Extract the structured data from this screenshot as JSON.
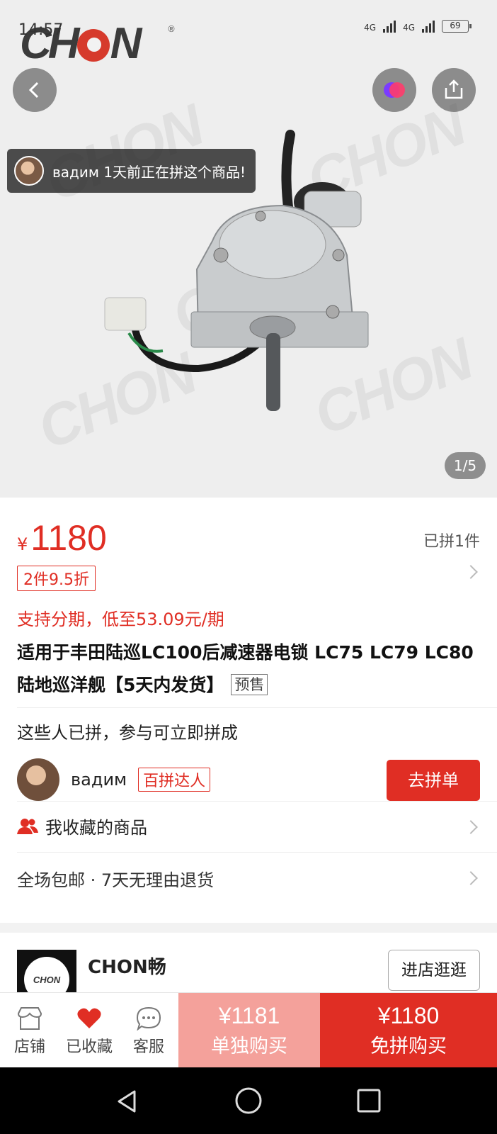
{
  "status": {
    "time": "14:57",
    "network": "4G",
    "battery": "69"
  },
  "hero": {
    "brand_logo": "CHON",
    "viewer_notice": "вадим 1天前正在拼这个商品!",
    "pager": "1/5"
  },
  "product": {
    "currency": "¥",
    "price": "1180",
    "sold": "已拼1件",
    "discount_tag": "2件9.5折",
    "installment": "支持分期，低至53.09元/期",
    "title": "适用于丰田陆巡LC100后减速器电锁 LC75 LC79 LC80 陆地巡洋舰【5天内发货】",
    "presale_tag": "预售"
  },
  "group": {
    "heading": "这些人已拼，参与可立即拼成",
    "member_name": "вадим",
    "member_badge": "百拼达人",
    "join_label": "去拼单"
  },
  "favorites": {
    "label": "我收藏的商品"
  },
  "shipping": {
    "label": "全场包邮 · 7天无理由退货"
  },
  "store": {
    "name": "CHON畅",
    "visit_label": "进店逛逛",
    "logo_text": "CHON"
  },
  "actionbar": {
    "shop_label": "店铺",
    "fav_label": "已收藏",
    "service_label": "客服",
    "single_price": "¥1181",
    "single_label": "单独购买",
    "group_price": "¥1180",
    "group_label": "免拼购买"
  },
  "colors": {
    "accent": "#e02e24",
    "accent_light": "#f4a19b"
  }
}
